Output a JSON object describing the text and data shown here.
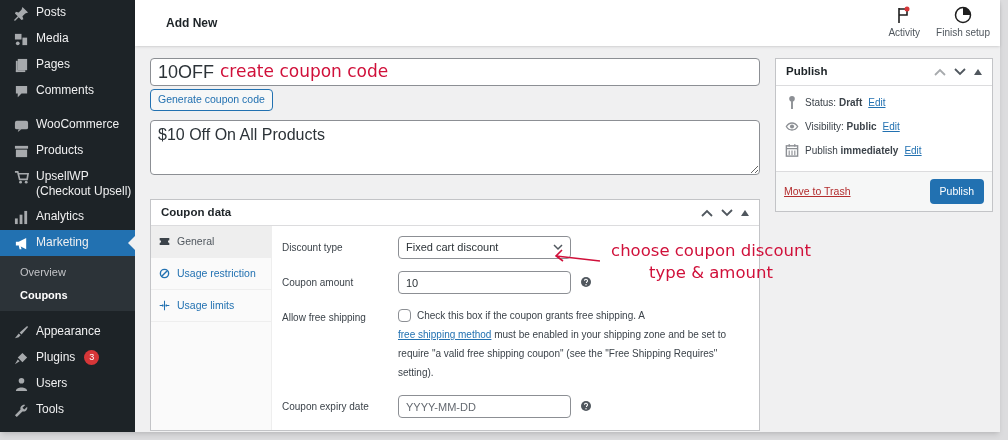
{
  "sidebar": {
    "groups": [
      {
        "items": [
          {
            "label": "Posts",
            "selected": false
          },
          {
            "label": "Media",
            "selected": false
          },
          {
            "label": "Pages",
            "selected": false
          },
          {
            "label": "Comments",
            "selected": false
          }
        ]
      },
      {
        "items": [
          {
            "label": "WooCommerce",
            "selected": false
          },
          {
            "label": "Products",
            "selected": false
          },
          {
            "label": "UpsellWP (Checkout Upsell)",
            "selected": false
          },
          {
            "label": "Analytics",
            "selected": false
          },
          {
            "label": "Marketing",
            "selected": true,
            "children": [
              {
                "label": "Overview",
                "selected": false
              },
              {
                "label": "Coupons",
                "selected": true
              }
            ]
          }
        ]
      },
      {
        "items": [
          {
            "label": "Appearance",
            "selected": false
          },
          {
            "label": "Plugins",
            "selected": false,
            "badge": "3"
          },
          {
            "label": "Users",
            "selected": false
          },
          {
            "label": "Tools",
            "selected": false
          }
        ]
      }
    ]
  },
  "header": {
    "title": "Add New",
    "actions": [
      {
        "label": "Activity",
        "notification": true
      },
      {
        "label": "Finish setup",
        "notification": false
      }
    ]
  },
  "coupon_code": {
    "value": "10OFF"
  },
  "generate_button": "Generate coupon code",
  "description": {
    "value": "$10 Off On All Products"
  },
  "coupon_data": {
    "title": "Coupon data",
    "tabs": [
      {
        "label": "General",
        "selected": true
      },
      {
        "label": "Usage restriction",
        "selected": false
      },
      {
        "label": "Usage limits",
        "selected": false
      }
    ],
    "fields": [
      {
        "kind": "select",
        "label": "Discount type",
        "value": "Fixed cart discount"
      },
      {
        "kind": "text",
        "label": "Coupon amount",
        "value": "10",
        "help": true
      },
      {
        "kind": "checkbox",
        "label": "Allow free shipping",
        "checked": false,
        "text_before": "Check this box if the coupon grants free shipping. A",
        "link": "free shipping method",
        "text_after": "must be enabled in your shipping zone and be set to require \"a valid free shipping coupon\" (see the \"Free Shipping Requires\" setting)."
      },
      {
        "kind": "text",
        "label": "Coupon expiry date",
        "placeholder": "YYYY-MM-DD",
        "help": true
      }
    ]
  },
  "publish": {
    "title": "Publish",
    "rows": [
      {
        "text": "Status: **Draft**",
        "link": "Edit"
      },
      {
        "text": "Visibility: **Public**",
        "link": "Edit"
      },
      {
        "text": "Publish **immediately**",
        "link": "Edit"
      }
    ],
    "trash": "Move to Trash",
    "button": "Publish"
  },
  "annotations": [
    {
      "text": "create coupon code"
    },
    {
      "text": "choose coupon discount type & amount"
    }
  ]
}
